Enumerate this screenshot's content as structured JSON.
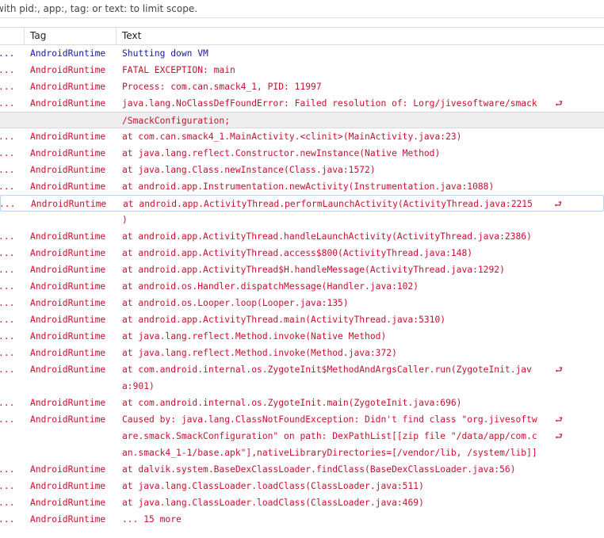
{
  "filter": {
    "placeholder": "with pid:, app:, tag: or text: to limit scope."
  },
  "columns": {
    "dots": "",
    "tag": "Tag",
    "text": "Text"
  },
  "colors": {
    "info": "#1a1aa0",
    "error": "#c8102e",
    "selected_bg": "#eeeeee",
    "hover_border": "#b8d6f0"
  },
  "wrap_glyph": "⮐",
  "rows": [
    {
      "app": "...",
      "tag": "AndroidRuntime",
      "text": "Shutting down VM",
      "level": "I",
      "wrap": false
    },
    {
      "app": "...",
      "tag": "AndroidRuntime",
      "text": "FATAL EXCEPTION: main",
      "level": "E",
      "wrap": false
    },
    {
      "app": "...",
      "tag": "AndroidRuntime",
      "text": "Process: com.can.smack4_1, PID: 11997",
      "level": "E",
      "wrap": false
    },
    {
      "app": "...",
      "tag": "AndroidRuntime",
      "text": "java.lang.NoClassDefFoundError: Failed resolution of: Lorg/jivesoftware/smack",
      "level": "E",
      "wrap": true
    },
    {
      "app": "",
      "tag": "",
      "text": "/SmackConfiguration;",
      "level": "E",
      "wrap": false,
      "selected": true
    },
    {
      "app": "...",
      "tag": "AndroidRuntime",
      "text": "at com.can.smack4_1.MainActivity.<clinit>(MainActivity.java:23)",
      "level": "E",
      "wrap": false
    },
    {
      "app": "...",
      "tag": "AndroidRuntime",
      "text": "at java.lang.reflect.Constructor.newInstance(Native Method)",
      "level": "E",
      "wrap": false
    },
    {
      "app": "...",
      "tag": "AndroidRuntime",
      "text": "at java.lang.Class.newInstance(Class.java:1572)",
      "level": "E",
      "wrap": false
    },
    {
      "app": "...",
      "tag": "AndroidRuntime",
      "text": "at android.app.Instrumentation.newActivity(Instrumentation.java:1088)",
      "level": "E",
      "wrap": false
    },
    {
      "app": "...",
      "tag": "AndroidRuntime",
      "text": "at android.app.ActivityThread.performLaunchActivity(ActivityThread.java:2215",
      "level": "E",
      "wrap": true,
      "hover": true
    },
    {
      "app": "",
      "tag": "",
      "text": ")",
      "level": "E",
      "wrap": false
    },
    {
      "app": "...",
      "tag": "AndroidRuntime",
      "text": "at android.app.ActivityThread.handleLaunchActivity(ActivityThread.java:2386)",
      "level": "E",
      "wrap": false
    },
    {
      "app": "...",
      "tag": "AndroidRuntime",
      "text": "at android.app.ActivityThread.access$800(ActivityThread.java:148)",
      "level": "E",
      "wrap": false
    },
    {
      "app": "...",
      "tag": "AndroidRuntime",
      "text": "at android.app.ActivityThread$H.handleMessage(ActivityThread.java:1292)",
      "level": "E",
      "wrap": false
    },
    {
      "app": "...",
      "tag": "AndroidRuntime",
      "text": "at android.os.Handler.dispatchMessage(Handler.java:102)",
      "level": "E",
      "wrap": false
    },
    {
      "app": "...",
      "tag": "AndroidRuntime",
      "text": "at android.os.Looper.loop(Looper.java:135)",
      "level": "E",
      "wrap": false
    },
    {
      "app": "...",
      "tag": "AndroidRuntime",
      "text": "at android.app.ActivityThread.main(ActivityThread.java:5310)",
      "level": "E",
      "wrap": false
    },
    {
      "app": "...",
      "tag": "AndroidRuntime",
      "text": "at java.lang.reflect.Method.invoke(Native Method)",
      "level": "E",
      "wrap": false
    },
    {
      "app": "...",
      "tag": "AndroidRuntime",
      "text": "at java.lang.reflect.Method.invoke(Method.java:372)",
      "level": "E",
      "wrap": false
    },
    {
      "app": "...",
      "tag": "AndroidRuntime",
      "text": "at com.android.internal.os.ZygoteInit$MethodAndArgsCaller.run(ZygoteInit.jav",
      "level": "E",
      "wrap": true
    },
    {
      "app": "",
      "tag": "",
      "text": "a:901)",
      "level": "E",
      "wrap": false
    },
    {
      "app": "...",
      "tag": "AndroidRuntime",
      "text": "at com.android.internal.os.ZygoteInit.main(ZygoteInit.java:696)",
      "level": "E",
      "wrap": false
    },
    {
      "app": "...",
      "tag": "AndroidRuntime",
      "text": "Caused by: java.lang.ClassNotFoundException: Didn't find class \"org.jivesoftw",
      "level": "E",
      "wrap": true
    },
    {
      "app": "",
      "tag": "",
      "text": "are.smack.SmackConfiguration\" on path: DexPathList[[zip file \"/data/app/com.c",
      "level": "E",
      "wrap": true
    },
    {
      "app": "",
      "tag": "",
      "text": "an.smack4_1-1/base.apk\"],nativeLibraryDirectories=[/vendor/lib, /system/lib]]",
      "level": "E",
      "wrap": false
    },
    {
      "app": "...",
      "tag": "AndroidRuntime",
      "text": "at dalvik.system.BaseDexClassLoader.findClass(BaseDexClassLoader.java:56)",
      "level": "E",
      "wrap": false
    },
    {
      "app": "...",
      "tag": "AndroidRuntime",
      "text": "at java.lang.ClassLoader.loadClass(ClassLoader.java:511)",
      "level": "E",
      "wrap": false
    },
    {
      "app": "...",
      "tag": "AndroidRuntime",
      "text": "at java.lang.ClassLoader.loadClass(ClassLoader.java:469)",
      "level": "E",
      "wrap": false
    },
    {
      "app": "...",
      "tag": "AndroidRuntime",
      "text": "... 15 more",
      "level": "E",
      "wrap": false
    }
  ]
}
